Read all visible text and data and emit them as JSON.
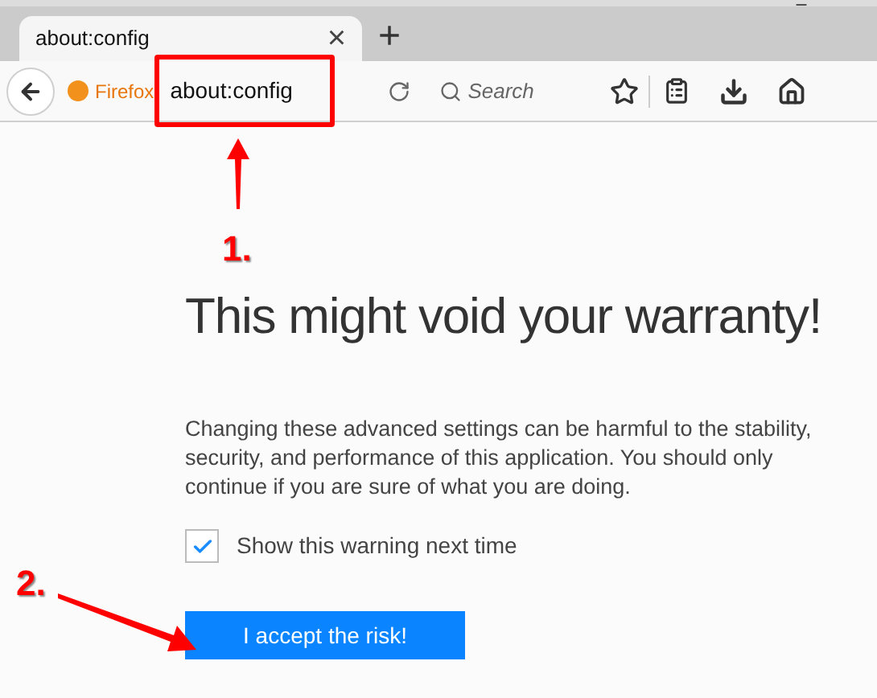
{
  "tab": {
    "title": "about:config",
    "close": "×",
    "new_tab": "+"
  },
  "toolbar": {
    "identity": "Firefox",
    "url": "about:config",
    "search": {
      "placeholder": "Search"
    }
  },
  "page": {
    "heading": "This might void your warranty!",
    "paragraph": [
      "Changing these advanced settings can be harmful to the stability,",
      "security, and performance of this application. You should only",
      "continue if you are sure of what you are doing."
    ],
    "checkbox": {
      "label": "Show this warning next time",
      "checked": true
    },
    "button": "I accept the risk!"
  },
  "annotations": [
    {
      "number": "1."
    },
    {
      "number": "2."
    }
  ]
}
